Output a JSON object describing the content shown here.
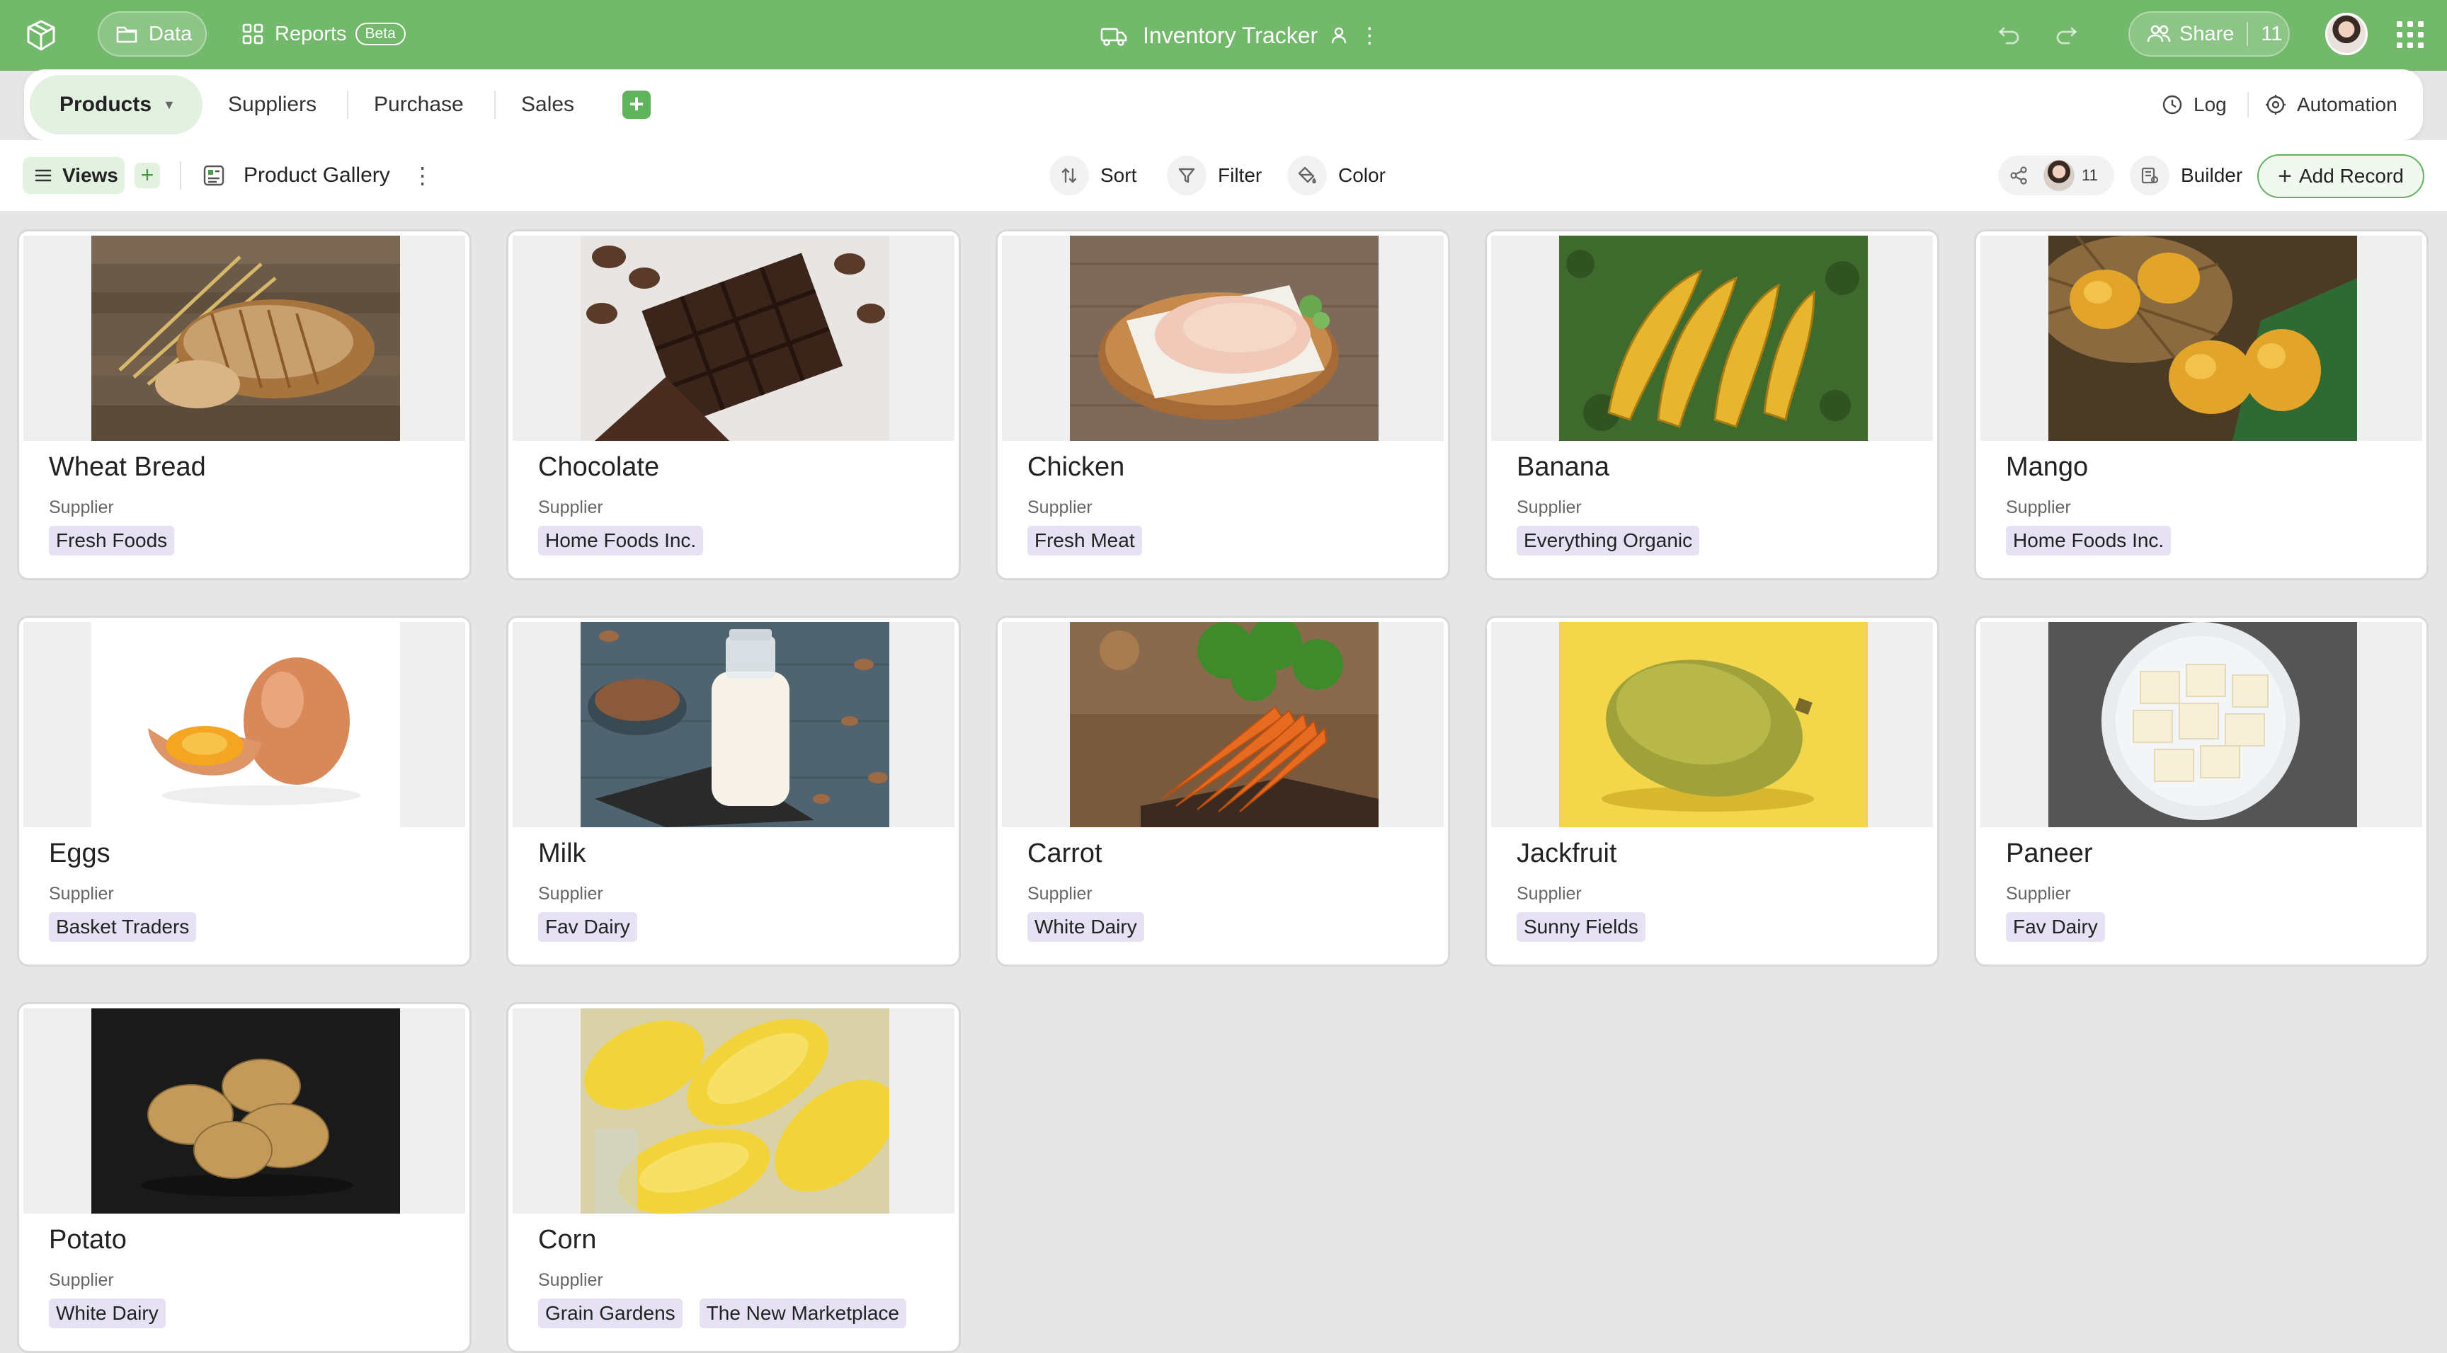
{
  "topbar": {
    "data_label": "Data",
    "reports_label": "Reports",
    "beta_label": "Beta",
    "app_title": "Inventory Tracker",
    "share_label": "Share",
    "share_count": "11"
  },
  "tabs": {
    "products": "Products",
    "suppliers": "Suppliers",
    "purchase": "Purchase",
    "sales": "Sales",
    "log": "Log",
    "automation": "Automation"
  },
  "toolbar": {
    "views_label": "Views",
    "view_name": "Product Gallery",
    "sort_label": "Sort",
    "filter_label": "Filter",
    "color_label": "Color",
    "collaborator_count": "11",
    "builder_label": "Builder",
    "add_record_label": "Add Record"
  },
  "card_field_label": "Supplier",
  "products": [
    {
      "name": "Wheat Bread",
      "suppliers": [
        "Fresh Foods"
      ]
    },
    {
      "name": "Chocolate",
      "suppliers": [
        "Home Foods Inc."
      ]
    },
    {
      "name": "Chicken",
      "suppliers": [
        "Fresh Meat"
      ]
    },
    {
      "name": "Banana",
      "suppliers": [
        "Everything Organic"
      ]
    },
    {
      "name": "Mango",
      "suppliers": [
        "Home Foods Inc."
      ]
    },
    {
      "name": "Eggs",
      "suppliers": [
        "Basket Traders"
      ]
    },
    {
      "name": "Milk",
      "suppliers": [
        "Fav Dairy"
      ]
    },
    {
      "name": "Carrot",
      "suppliers": [
        "White Dairy"
      ]
    },
    {
      "name": "Jackfruit",
      "suppliers": [
        "Sunny Fields"
      ]
    },
    {
      "name": "Paneer",
      "suppliers": [
        "Fav Dairy"
      ]
    },
    {
      "name": "Potato",
      "suppliers": [
        "White Dairy"
      ]
    },
    {
      "name": "Corn",
      "suppliers": [
        "Grain Gardens",
        "The New Marketplace"
      ]
    }
  ],
  "colors": {
    "brand_green": "#73b96b",
    "tag_bg": "#e6e1f3",
    "active_tab_bg": "#e3f1e1"
  }
}
